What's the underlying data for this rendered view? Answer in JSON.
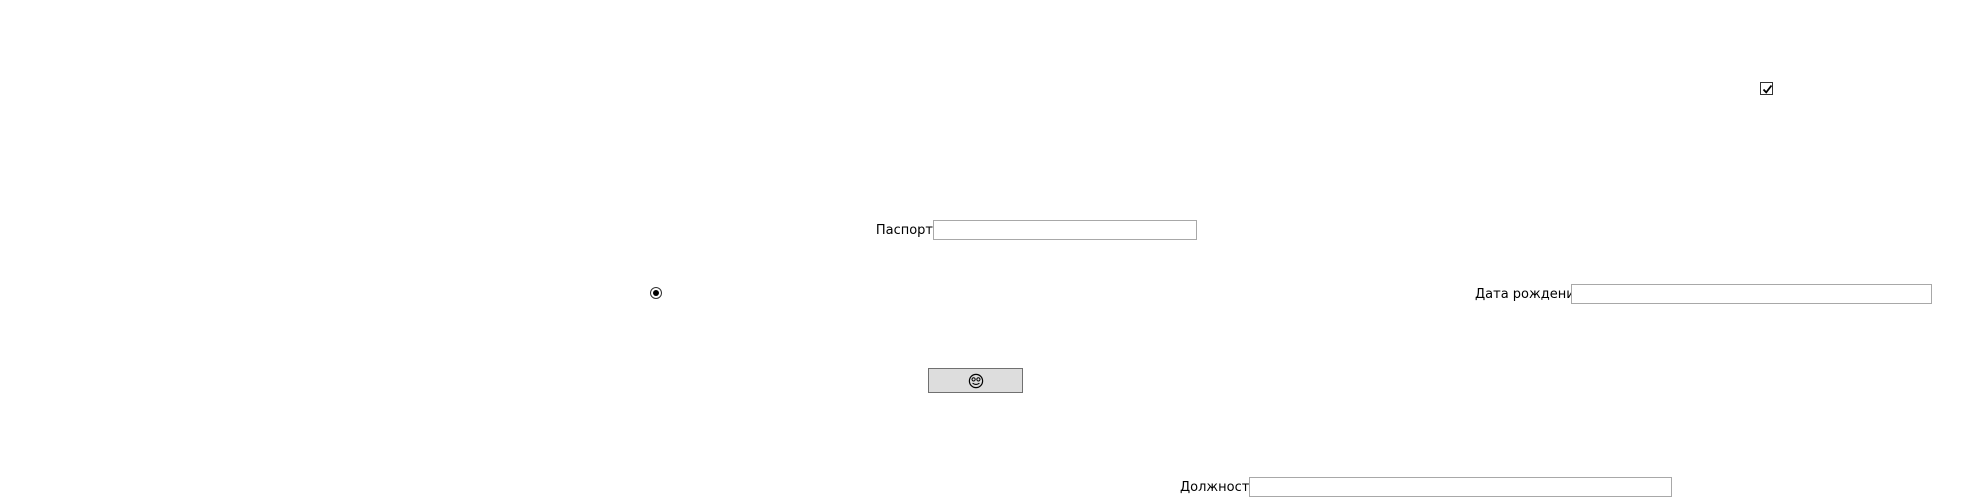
{
  "form": {
    "checkbox": {
      "checked": true
    },
    "passport": {
      "label": "Паспорт",
      "value": ""
    },
    "radio": {
      "selected": true
    },
    "birth_date": {
      "label": "Дата рождения",
      "value": ""
    },
    "action_button": {
      "icon": "face-icon"
    },
    "position": {
      "label": "Должность",
      "value": ""
    }
  }
}
